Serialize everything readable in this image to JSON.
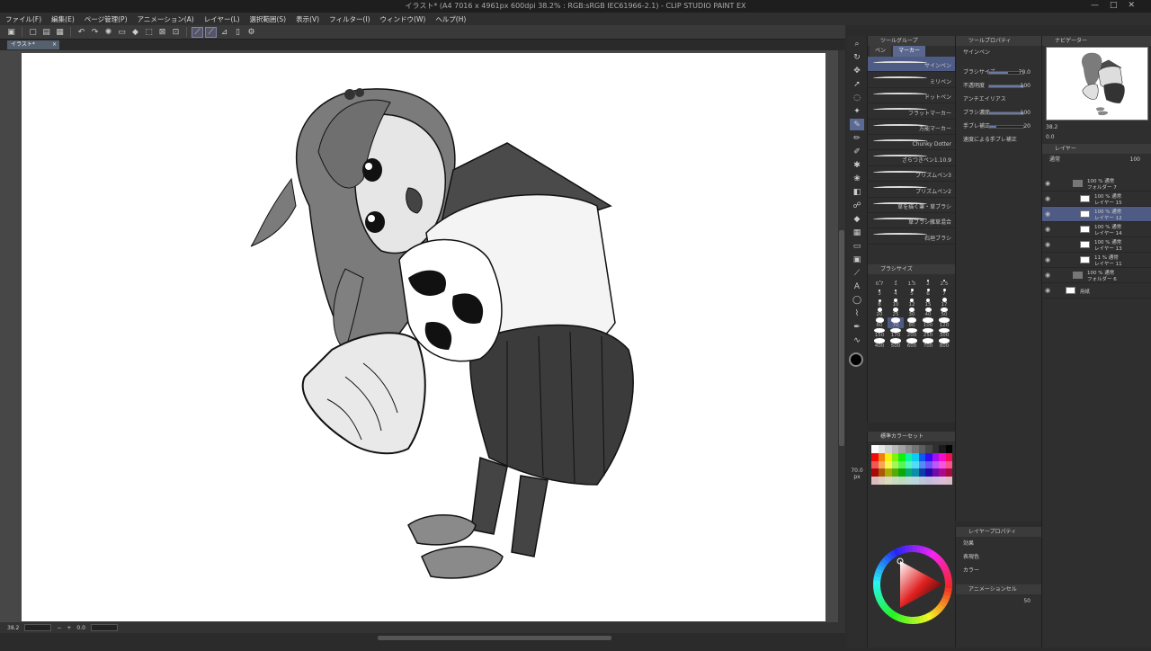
{
  "window": {
    "title": "イラスト* (A4 7016 x 4961px 600dpi 38.2% : RGB:sRGB IEC61966-2.1) - CLIP STUDIO PAINT EX",
    "controls": [
      "—",
      "□",
      "✕"
    ]
  },
  "menu": [
    "ファイル(F)",
    "編集(E)",
    "ページ管理(P)",
    "アニメーション(A)",
    "レイヤー(L)",
    "選択範囲(S)",
    "表示(V)",
    "フィルター(I)",
    "ウィンドウ(W)",
    "ヘルプ(H)"
  ],
  "document_tab": {
    "label": "イラスト*",
    "close": "×"
  },
  "statusbar": {
    "zoom": "38.2",
    "angle": "0.0"
  },
  "tool_groups": {
    "tool_tab": "ツールグループ",
    "subtool_tabs": [
      "ペン",
      "マーカー"
    ],
    "brushes": [
      {
        "label": "サインペン",
        "active": true
      },
      {
        "label": "ミリペン",
        "active": false
      },
      {
        "label": "ドットペン",
        "active": false
      },
      {
        "label": "フラットマーカー",
        "active": false
      },
      {
        "label": "万能マーカー",
        "active": false
      },
      {
        "label": "Chunky Dotter",
        "active": false
      },
      {
        "label": "ざらつきペン1.10.9",
        "active": false
      },
      {
        "label": "プリズムペン3",
        "active": false
      },
      {
        "label": "プリズムペン2",
        "active": false
      },
      {
        "label": "草を描く筆・草ブラシ",
        "active": false
      },
      {
        "label": "草ブラシ雑草混合",
        "active": false
      },
      {
        "label": "石垣ブラシ",
        "active": false
      }
    ]
  },
  "tool_property": {
    "title": "ツールプロパティ",
    "brush_name": "サインペン",
    "rows": [
      {
        "label": "ブラシサイズ",
        "value": "70.0",
        "fill": 0.55
      },
      {
        "label": "不透明度",
        "value": "100",
        "fill": 1.0
      },
      {
        "label": "アンチエイリアス",
        "value": "",
        "fill": 0
      },
      {
        "label": "ブラシ濃度",
        "value": "100",
        "fill": 1.0
      },
      {
        "label": "手ブレ補正",
        "value": "20",
        "fill": 0.2
      },
      {
        "label": "速度による手ブレ補正",
        "value": "",
        "fill": 0
      }
    ]
  },
  "brush_size": {
    "title": "ブラシサイズ",
    "sizes": [
      "0.7",
      "1",
      "1.5",
      "2",
      "2.5",
      "3",
      "4",
      "5",
      "6",
      "7",
      "8",
      "10",
      "12",
      "15",
      "17",
      "20",
      "25",
      "30",
      "40",
      "50",
      "60",
      "70",
      "80",
      "100",
      "120",
      "150",
      "170",
      "200",
      "250",
      "300",
      "400",
      "500",
      "600",
      "700",
      "800"
    ],
    "selected": "70"
  },
  "color_set": {
    "title": "標準カラーセット",
    "tab2": "カラーセット"
  },
  "side_size": {
    "value": "70.0",
    "unit": "px",
    "opacity": "100"
  },
  "navigator": {
    "title": "ナビゲーター",
    "zoom": "38.2",
    "angle": "0.0"
  },
  "layers": {
    "title": "レイヤー",
    "blend": "通常",
    "opacity": "100",
    "rows": [
      {
        "l1": "100 % 通常",
        "l2": "フォルダー 7",
        "type": "folder",
        "active": false,
        "indent": 1
      },
      {
        "l1": "100 % 通常",
        "l2": "レイヤー 15",
        "type": "layer",
        "active": false,
        "indent": 2
      },
      {
        "l1": "100 % 通常",
        "l2": "レイヤー 12",
        "type": "layer",
        "active": true,
        "indent": 2
      },
      {
        "l1": "100 % 通常",
        "l2": "レイヤー 14",
        "type": "layer",
        "active": false,
        "indent": 2
      },
      {
        "l1": "100 % 通常",
        "l2": "レイヤー 13",
        "type": "layer",
        "active": false,
        "indent": 2
      },
      {
        "l1": "11 % 通常",
        "l2": "レイヤー 11",
        "type": "layer",
        "active": false,
        "indent": 2
      },
      {
        "l1": "100 % 通常",
        "l2": "フォルダー 6",
        "type": "folder",
        "active": false,
        "indent": 1
      },
      {
        "l1": "用紙",
        "l2": "",
        "type": "paper",
        "active": false,
        "indent": 0
      }
    ]
  },
  "layer_property": {
    "title": "レイヤープロパティ",
    "effect": "効果",
    "expression": "表現色",
    "color_mode": "カラー"
  },
  "animation": {
    "title": "アニメーションセル",
    "value": "50"
  }
}
